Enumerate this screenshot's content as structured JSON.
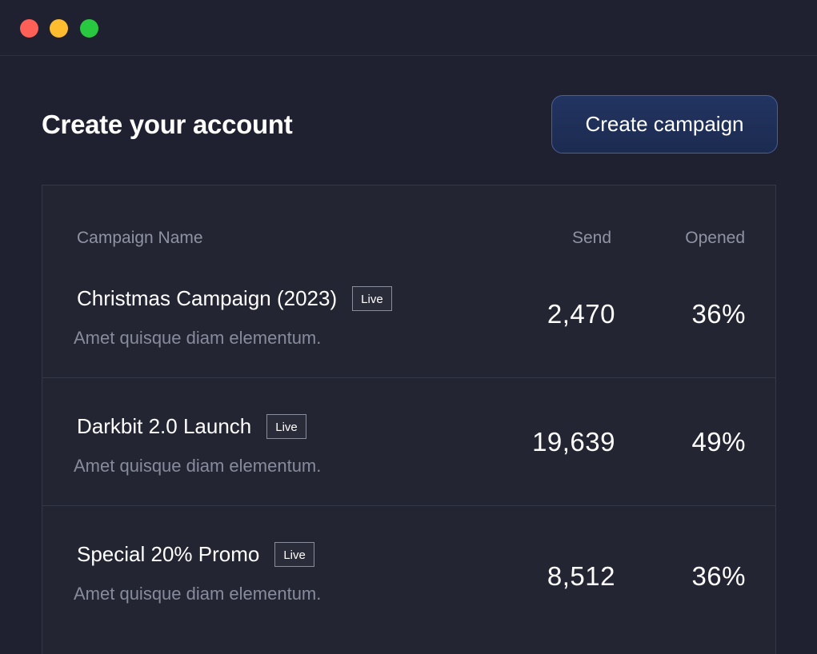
{
  "window": {
    "controls": [
      "close-icon",
      "minimize-icon",
      "zoom-icon"
    ]
  },
  "header": {
    "title": "Create your account",
    "create_button_label": "Create campaign"
  },
  "table": {
    "columns": {
      "name": "Campaign Name",
      "send": "Send",
      "opened": "Opened"
    },
    "rows": [
      {
        "name": "Christmas Campaign (2023)",
        "status": "Live",
        "description": "Amet quisque diam elementum.",
        "send": "2,470",
        "opened": "36%"
      },
      {
        "name": "Darkbit 2.0 Launch",
        "status": "Live",
        "description": "Amet quisque diam elementum.",
        "send": "19,639",
        "opened": "49%"
      },
      {
        "name": "Special 20% Promo",
        "status": "Live",
        "description": "Amet quisque diam elementum.",
        "send": "8,512",
        "opened": "36%"
      }
    ]
  },
  "colors": {
    "background": "#1f2130",
    "panel": "#232533",
    "accent_button": "#223461",
    "close": "#fe5f57",
    "minimize": "#febc2e",
    "zoom": "#28c840"
  }
}
